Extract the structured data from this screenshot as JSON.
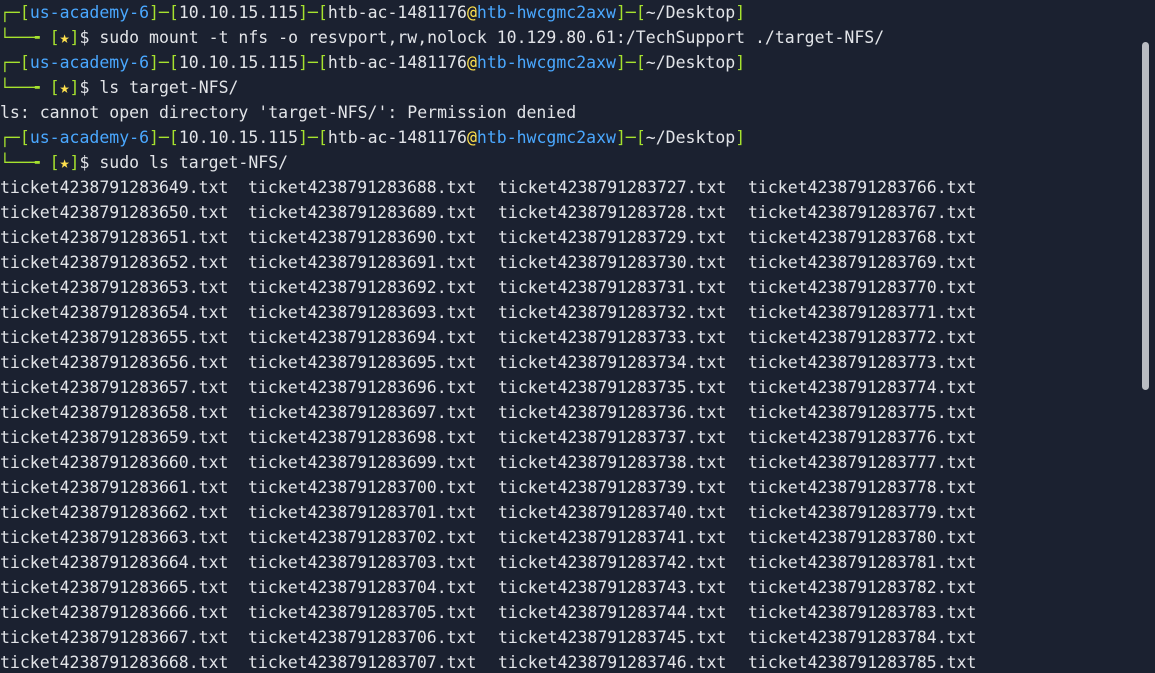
{
  "prompt": {
    "host": "us-academy-6",
    "ip": "10.10.15.115",
    "user": "htb-ac-1481176",
    "at": "@",
    "machine": "htb-hwcgmc2axw",
    "dir": "~/Desktop",
    "star": "★",
    "dollar": "$"
  },
  "commands": [
    "sudo mount -t nfs -o resvport,rw,nolock 10.129.80.61:/TechSupport ./target-NFS/",
    "ls target-NFS/",
    "sudo ls target-NFS/"
  ],
  "error_line": "ls: cannot open directory 'target-NFS/': Permission denied",
  "files": [
    [
      "ticket4238791283649.txt",
      "ticket4238791283688.txt",
      "ticket4238791283727.txt",
      "ticket4238791283766.txt"
    ],
    [
      "ticket4238791283650.txt",
      "ticket4238791283689.txt",
      "ticket4238791283728.txt",
      "ticket4238791283767.txt"
    ],
    [
      "ticket4238791283651.txt",
      "ticket4238791283690.txt",
      "ticket4238791283729.txt",
      "ticket4238791283768.txt"
    ],
    [
      "ticket4238791283652.txt",
      "ticket4238791283691.txt",
      "ticket4238791283730.txt",
      "ticket4238791283769.txt"
    ],
    [
      "ticket4238791283653.txt",
      "ticket4238791283692.txt",
      "ticket4238791283731.txt",
      "ticket4238791283770.txt"
    ],
    [
      "ticket4238791283654.txt",
      "ticket4238791283693.txt",
      "ticket4238791283732.txt",
      "ticket4238791283771.txt"
    ],
    [
      "ticket4238791283655.txt",
      "ticket4238791283694.txt",
      "ticket4238791283733.txt",
      "ticket4238791283772.txt"
    ],
    [
      "ticket4238791283656.txt",
      "ticket4238791283695.txt",
      "ticket4238791283734.txt",
      "ticket4238791283773.txt"
    ],
    [
      "ticket4238791283657.txt",
      "ticket4238791283696.txt",
      "ticket4238791283735.txt",
      "ticket4238791283774.txt"
    ],
    [
      "ticket4238791283658.txt",
      "ticket4238791283697.txt",
      "ticket4238791283736.txt",
      "ticket4238791283775.txt"
    ],
    [
      "ticket4238791283659.txt",
      "ticket4238791283698.txt",
      "ticket4238791283737.txt",
      "ticket4238791283776.txt"
    ],
    [
      "ticket4238791283660.txt",
      "ticket4238791283699.txt",
      "ticket4238791283738.txt",
      "ticket4238791283777.txt"
    ],
    [
      "ticket4238791283661.txt",
      "ticket4238791283700.txt",
      "ticket4238791283739.txt",
      "ticket4238791283778.txt"
    ],
    [
      "ticket4238791283662.txt",
      "ticket4238791283701.txt",
      "ticket4238791283740.txt",
      "ticket4238791283779.txt"
    ],
    [
      "ticket4238791283663.txt",
      "ticket4238791283702.txt",
      "ticket4238791283741.txt",
      "ticket4238791283780.txt"
    ],
    [
      "ticket4238791283664.txt",
      "ticket4238791283703.txt",
      "ticket4238791283742.txt",
      "ticket4238791283781.txt"
    ],
    [
      "ticket4238791283665.txt",
      "ticket4238791283704.txt",
      "ticket4238791283743.txt",
      "ticket4238791283782.txt"
    ],
    [
      "ticket4238791283666.txt",
      "ticket4238791283705.txt",
      "ticket4238791283744.txt",
      "ticket4238791283783.txt"
    ],
    [
      "ticket4238791283667.txt",
      "ticket4238791283706.txt",
      "ticket4238791283745.txt",
      "ticket4238791283784.txt"
    ],
    [
      "ticket4238791283668.txt",
      "ticket4238791283707.txt",
      "ticket4238791283746.txt",
      "ticket4238791283785.txt"
    ]
  ],
  "colors": {
    "background": "#1b2130",
    "frame": "#a6e22e",
    "host": "#4aa8ff",
    "star": "#ffe14d",
    "text": "#e2e4e8"
  }
}
